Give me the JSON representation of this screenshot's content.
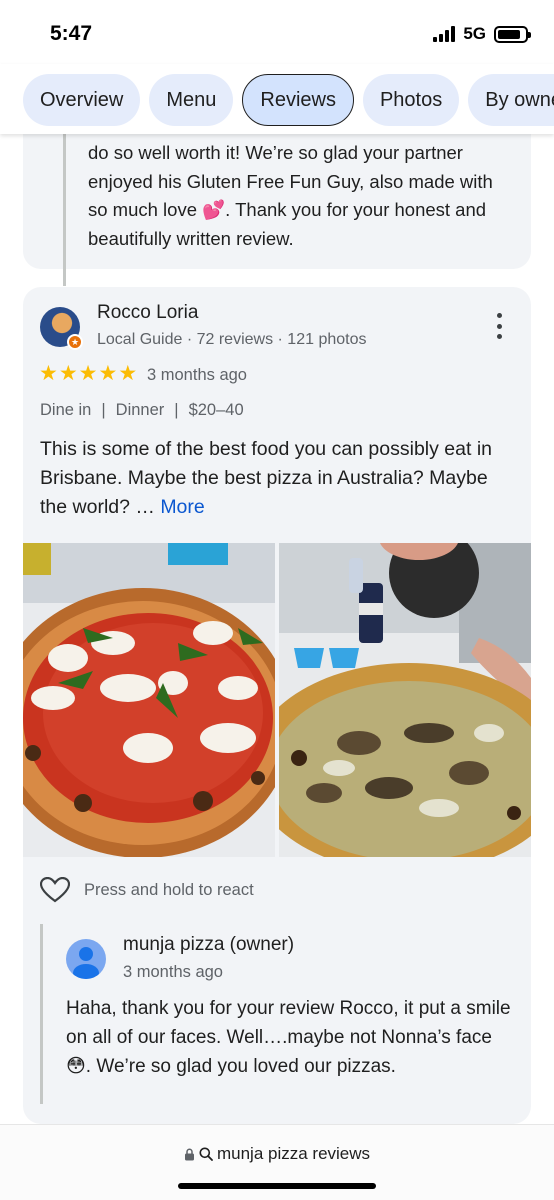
{
  "status": {
    "time": "5:47",
    "network": "5G",
    "battery_level": 0.85
  },
  "tabs": [
    {
      "label": "Overview",
      "active": false
    },
    {
      "label": "Menu",
      "active": false
    },
    {
      "label": "Reviews",
      "active": true
    },
    {
      "label": "Photos",
      "active": false
    },
    {
      "label": "By owner",
      "active": false
    }
  ],
  "previous_reply": {
    "lines": [
      "do so well worth it! We’re so glad your partner",
      "enjoyed his Gluten Free Fun Guy, also made with",
      "so much love 💕. Thank you for your honest and",
      "beautifully written review."
    ]
  },
  "review": {
    "reviewer_name": "Rocco Loria",
    "reviewer_meta": "Local Guide · 72 reviews · 121 photos",
    "rating": 5,
    "time": "3 months ago",
    "tags": [
      "Dine in",
      "Dinner",
      "$20–40"
    ],
    "text": "This is some of the best food you can possibly eat in Brisbane. Maybe the best pizza in Australia? Maybe the world? …",
    "more_label": "More",
    "react_label": "Press and hold to react",
    "owner_reply": {
      "name": "munja pizza (owner)",
      "time": "3 months ago",
      "text": "Haha, thank you for your review Rocco, it put a smile on all of our faces. Well….maybe not Nonna’s face 😳. We’re so glad you loved our pizzas."
    }
  },
  "browser": {
    "url_text": "munja pizza reviews"
  },
  "colors": {
    "star": "#fbbc04",
    "link": "#0b57d0",
    "tab_bg": "#e5ecfb",
    "tab_active_bg": "#d3e3fd"
  }
}
